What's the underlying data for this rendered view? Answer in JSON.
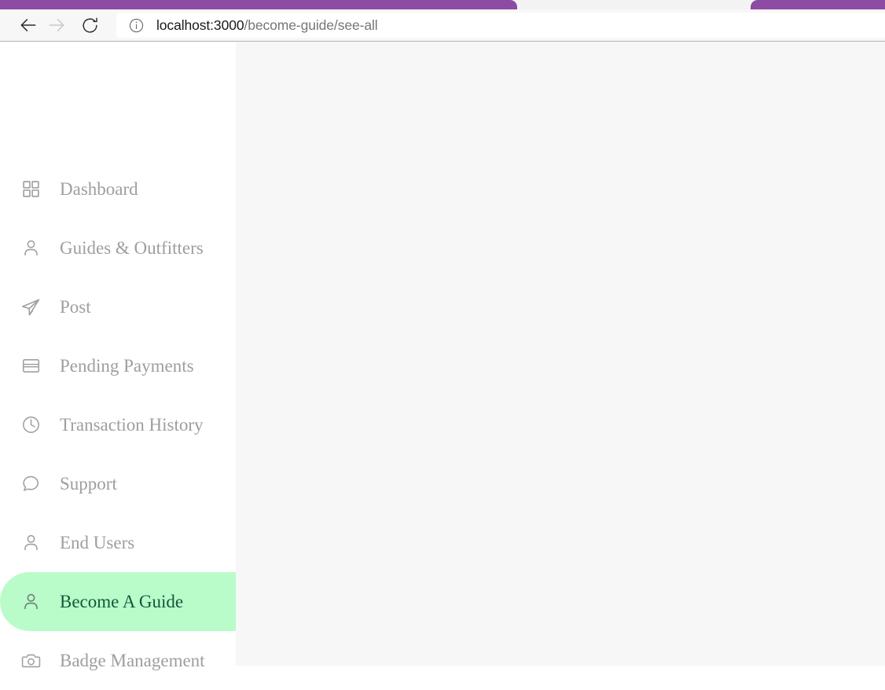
{
  "browser": {
    "tabs": [
      {
        "name": "tab-left",
        "color": "#8e4ba3"
      },
      {
        "name": "tab-right",
        "color": "#8e4ba3"
      }
    ],
    "toolbar": {
      "back_icon": "arrow-left-icon",
      "forward_icon": "arrow-right-icon",
      "reload_icon": "reload-icon",
      "site_info_icon": "info-circle-icon",
      "url_host": "localhost:3000",
      "url_path": "/become-guide/see-all",
      "url_full": "localhost:3000/become-guide/see-all"
    }
  },
  "sidebar": {
    "active_index": 7,
    "active_bg": "#b9fcca",
    "active_text_color": "#12593a",
    "items": [
      {
        "label": "Dashboard",
        "icon": "grid-icon",
        "slug": "dashboard"
      },
      {
        "label": "Guides & Outfitters",
        "icon": "user-icon",
        "slug": "guides-outfitters"
      },
      {
        "label": "Post",
        "icon": "send-icon",
        "slug": "post"
      },
      {
        "label": "Pending Payments",
        "icon": "credit-card-icon",
        "slug": "pending-payments"
      },
      {
        "label": "Transaction History",
        "icon": "clock-icon",
        "slug": "transaction-history"
      },
      {
        "label": "Support",
        "icon": "chat-bubble-icon",
        "slug": "support"
      },
      {
        "label": "End Users",
        "icon": "user-icon",
        "slug": "end-users"
      },
      {
        "label": "Become A Guide",
        "icon": "user-icon",
        "slug": "become-a-guide"
      },
      {
        "label": "Badge Management",
        "icon": "camera-icon",
        "slug": "badge-management"
      }
    ]
  },
  "main": {
    "background": "#f7f7f7",
    "content": ""
  }
}
